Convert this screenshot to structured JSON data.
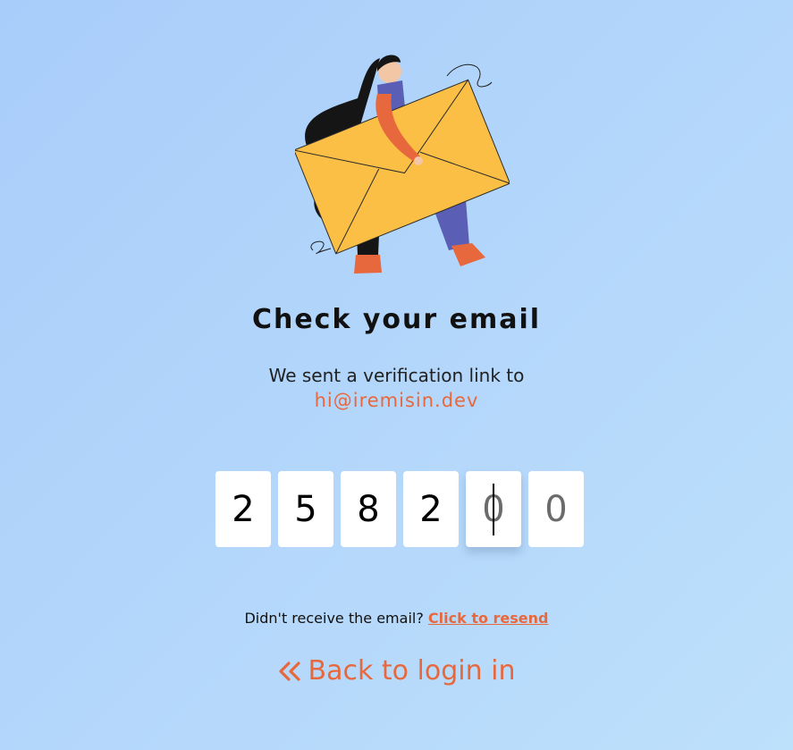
{
  "header": {
    "title": "Check your email",
    "message": "We sent a verification link to",
    "email": "hi@iremisin.dev"
  },
  "otp": {
    "digits": [
      "2",
      "5",
      "8",
      "2",
      "0",
      "0"
    ],
    "active_index": 4
  },
  "resend": {
    "prompt": "Didn't receive the email?",
    "link_label": "Click to resend"
  },
  "back": {
    "label": "Back to login in",
    "icon": "double-chevron-left-icon"
  },
  "colors": {
    "accent": "#e8683d",
    "background": "#b1d4fa",
    "envelope": "#fbbf45"
  }
}
